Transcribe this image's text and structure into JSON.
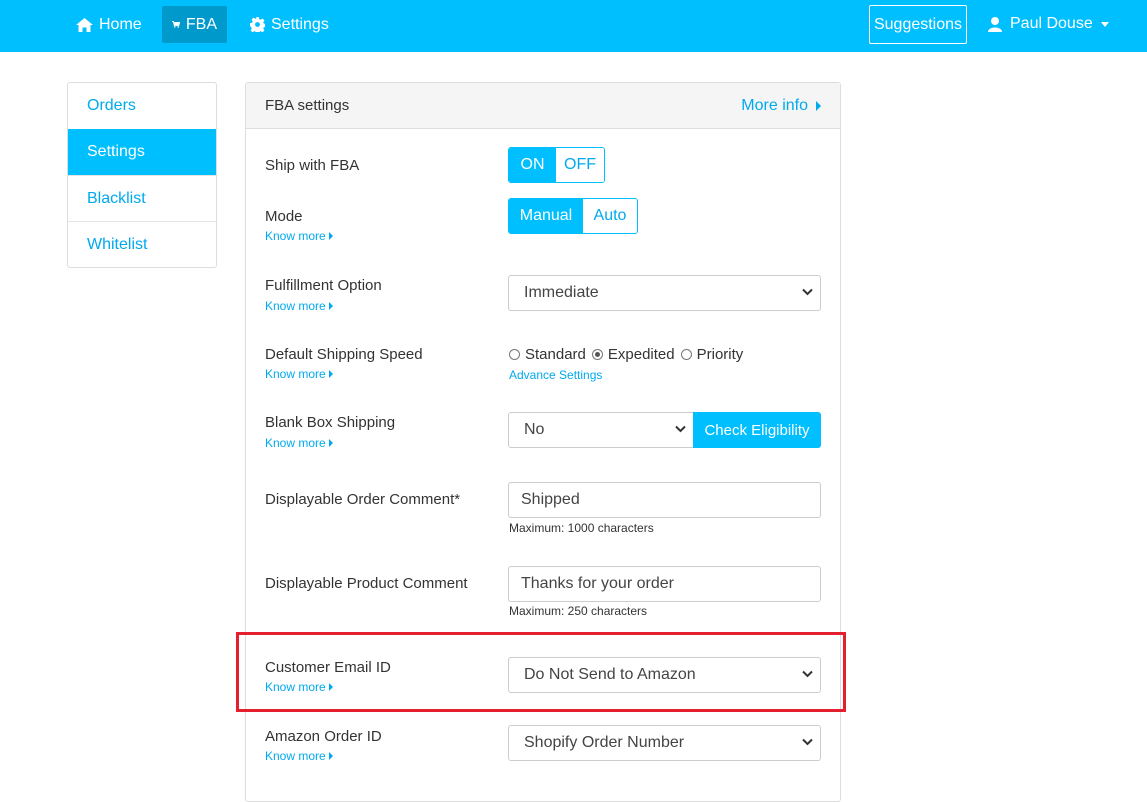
{
  "nav": {
    "home_label": "Home",
    "fba_label": "FBA",
    "settings_label": "Settings",
    "suggestions_label": "Suggestions",
    "user_name": "Paul Douse",
    "icons": [
      "home-icon",
      "cart-icon",
      "gear-icon",
      "user-icon",
      "caret-down-icon"
    ]
  },
  "sidebar": {
    "items": [
      {
        "label": "Orders",
        "active": false
      },
      {
        "label": "Settings",
        "active": true
      },
      {
        "label": "Blacklist",
        "active": false
      },
      {
        "label": "Whitelist",
        "active": false
      }
    ]
  },
  "panel": {
    "title": "FBA settings",
    "more_info": "More info"
  },
  "know_more": "Know more",
  "fields": {
    "ship_with_fba": {
      "label": "Ship with FBA",
      "on": "ON",
      "off": "OFF",
      "value": "ON"
    },
    "mode": {
      "label": "Mode",
      "manual": "Manual",
      "auto": "Auto",
      "value": "Manual"
    },
    "fulfillment_option": {
      "label": "Fulfillment Option",
      "value": "Immediate"
    },
    "default_shipping_speed": {
      "label": "Default Shipping Speed",
      "options": [
        "Standard",
        "Expedited",
        "Priority"
      ],
      "value": "Expedited",
      "advance_link": "Advance Settings"
    },
    "blank_box_shipping": {
      "label": "Blank Box Shipping",
      "value": "No",
      "button": "Check Eligibility"
    },
    "order_comment": {
      "label": "Displayable Order Comment*",
      "value": "Shipped",
      "hint": "Maximum: 1000 characters"
    },
    "product_comment": {
      "label": "Displayable Product Comment",
      "value": "Thanks for your order",
      "hint": "Maximum: 250 characters"
    },
    "customer_email": {
      "label": "Customer Email ID",
      "value": "Do Not Send to Amazon"
    },
    "amazon_order_id": {
      "label": "Amazon Order ID",
      "value": "Shopify Order Number"
    }
  },
  "colors": {
    "brand": "#00bfff",
    "link": "#00aaee",
    "highlight": "#e5202e"
  }
}
